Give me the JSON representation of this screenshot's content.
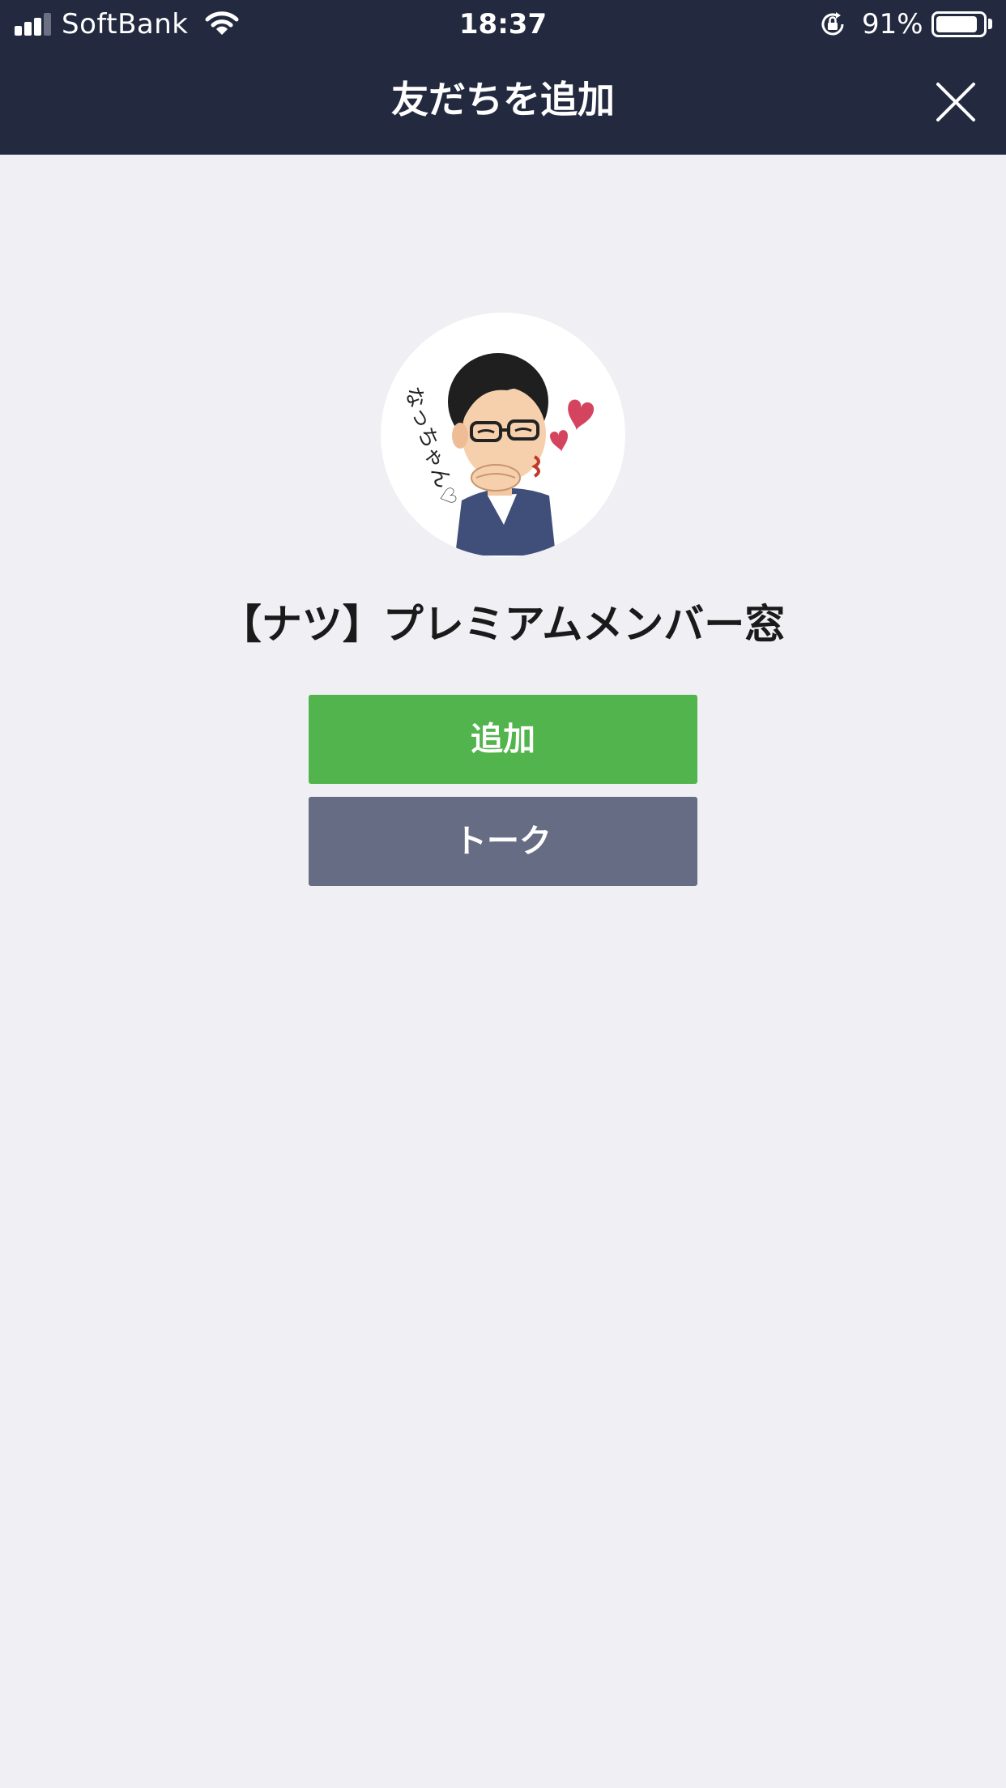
{
  "status_bar": {
    "carrier": "SoftBank",
    "time": "18:37",
    "battery_percent": "91%",
    "battery_level": 0.91,
    "signal_bars_active": 3,
    "signal_bars_total": 4,
    "icons": [
      "signal-icon",
      "wifi-icon",
      "rotation-lock-icon",
      "battery-icon"
    ]
  },
  "nav": {
    "title": "友だちを追加",
    "close_icon": "close-icon"
  },
  "profile": {
    "name": "【ナツ】プレミアムメンバー窓",
    "avatar_caption": "なっちゃん♡"
  },
  "actions": {
    "add_label": "追加",
    "talk_label": "トーク"
  },
  "colors": {
    "header_bg": "#232a40",
    "page_bg": "#efeff4",
    "add_button": "#52b44c",
    "talk_button": "#656c84"
  }
}
